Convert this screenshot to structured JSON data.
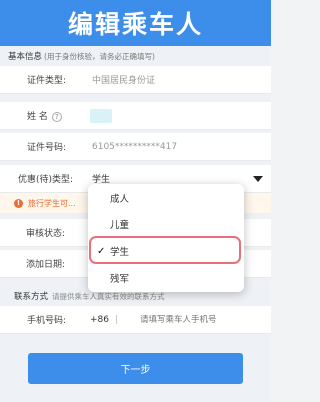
{
  "header": {
    "title": "编辑乘车人"
  },
  "basic_section": {
    "title": "基本信息",
    "hint": "(用于身份核验，请务必正确填写)"
  },
  "form": {
    "id_type": {
      "label": "证件类型:",
      "value": "中国居民身份证"
    },
    "name": {
      "label": "姓 名",
      "help": "?"
    },
    "id_number": {
      "label": "证件号码:",
      "value": "6105**********417"
    },
    "passenger_type": {
      "label": "优惠(待)类型:",
      "value": "学生"
    },
    "warning": {
      "icon": "!",
      "text": "旅行学生可..."
    },
    "review_status": {
      "label": "审核状态:"
    },
    "add_date": {
      "label": "添加日期:"
    }
  },
  "dropdown": {
    "options": [
      "成人",
      "儿童",
      "学生",
      "残军"
    ],
    "selected": "学生",
    "check": "✓"
  },
  "contact_section": {
    "title": "联系方式",
    "hint": "请提供乘车人真实有效的联系方式"
  },
  "phone": {
    "label": "手机号码:",
    "prefix": "+86",
    "separator": "|",
    "placeholder": "请填写乘车人手机号"
  },
  "buttons": {
    "next_label": "下一步"
  },
  "colors": {
    "primary": "#3d8eea",
    "warning": "#e36a2c",
    "highlight": "#e8707a"
  }
}
